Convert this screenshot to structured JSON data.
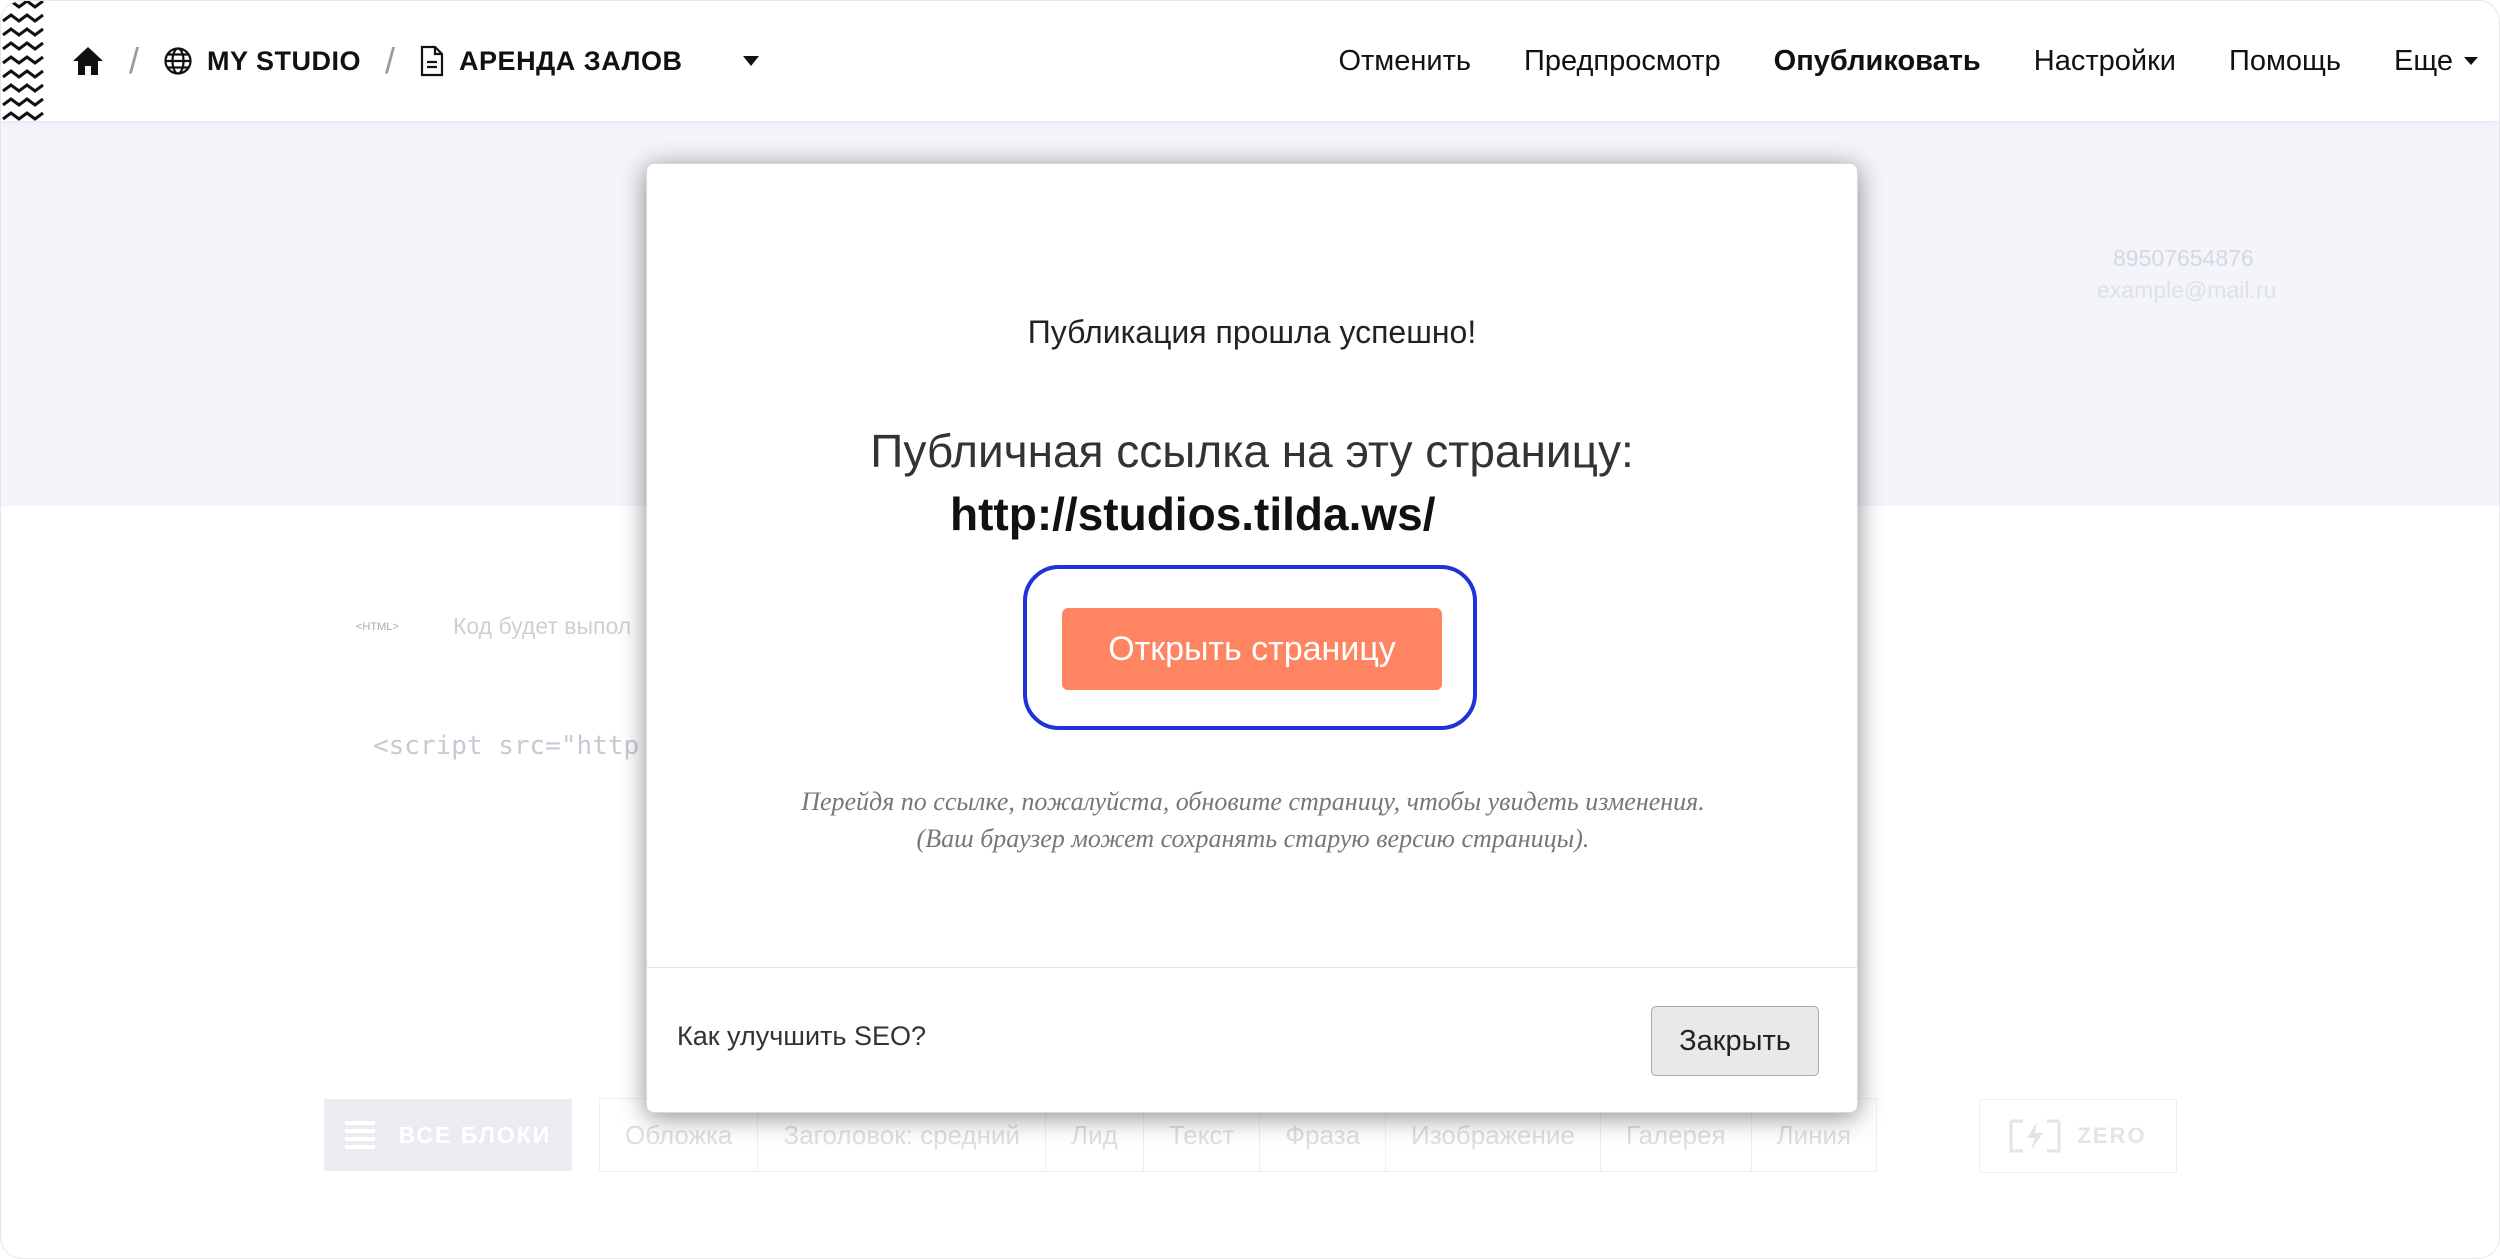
{
  "header": {
    "breadcrumb": {
      "home_icon": "home-icon",
      "separator": "/",
      "project_icon": "globe-icon",
      "project": "MY STUDIO",
      "page_icon": "document-icon",
      "page": "АРЕНДА ЗАЛОВ",
      "dropdown_icon": "caret-down-icon"
    },
    "nav": {
      "cancel": "Отменить",
      "preview": "Предпросмотр",
      "publish": "Опубликовать",
      "settings": "Настройки",
      "help": "Помощь",
      "more": "Еще"
    }
  },
  "background_page": {
    "contact_phone": "89507654876",
    "contact_email": "example@mail.ru",
    "html_block_tag": "<HTML>",
    "code_hint": "Код будет выпол",
    "script_line": "<script src=\"http",
    "block_bar": {
      "all_blocks": "ВСЕ БЛОКИ",
      "categories": [
        "Обложка",
        "Заголовок: средний",
        "Лид",
        "Текст",
        "Фраза",
        "Изображение",
        "Галерея",
        "Линия"
      ],
      "zero": "ZERO"
    }
  },
  "modal": {
    "success": "Публикация прошла успешно!",
    "link_label": "Публичная ссылка на эту страницу:",
    "url": "http://studios.tilda.ws/",
    "open_button": "Открыть страницу",
    "note": "Перейдя по ссылке, пожалуйста, обновите страницу, чтобы увидеть изменения. (Ваш браузер может сохранять старую версию страницы).",
    "seo_link": "Как улучшить SEO?",
    "close_button": "Закрыть"
  },
  "colors": {
    "accent_button": "#ff8562",
    "highlight_outline": "#1f33d8",
    "hero_background": "#f4f5fb"
  }
}
